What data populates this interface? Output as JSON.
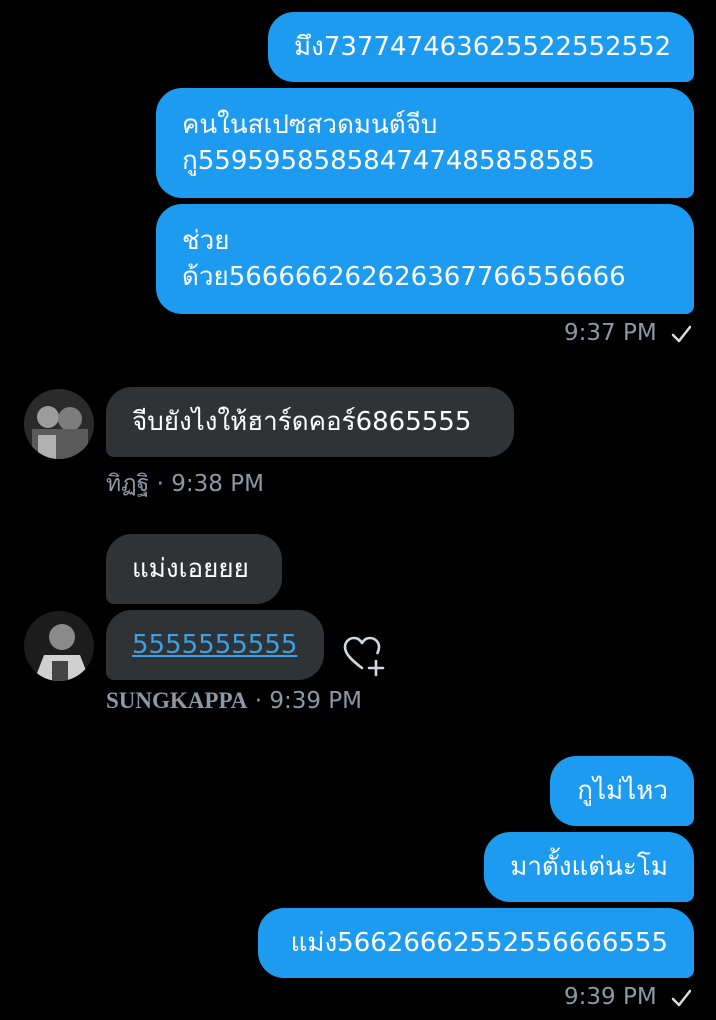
{
  "outgoing_group_1": {
    "messages": [
      "มึง7377474636255225525​52",
      "คนในสเปซสวดมนต์จีบ\nกู5595958585847474858585​85",
      "ช่วย\nด้วย566666262626367766556666"
    ],
    "time": "9:37 PM"
  },
  "incoming_1": {
    "message": "จีบยังไงให้ฮาร์ดคอร์6865555",
    "sender": "ทิฏฐิ",
    "time": "9:38 PM"
  },
  "incoming_2": {
    "messages": [
      "แม่งเอยยย",
      "5555555555"
    ],
    "sender": "SUNGKAPPA",
    "time": "9:39 PM"
  },
  "outgoing_group_2": {
    "messages": [
      "กูไม่ไหว",
      "มาตั้งแต่นะโม",
      "แม่ง566266625525566665​55"
    ],
    "time": "9:39 PM"
  },
  "colors": {
    "outgoing": "#1d9bf0",
    "incoming": "#2f3336",
    "meta": "#8b98a5",
    "link": "#3aa0e8"
  },
  "icons": {
    "read_receipt": "check-icon",
    "react": "heart-plus-icon"
  }
}
